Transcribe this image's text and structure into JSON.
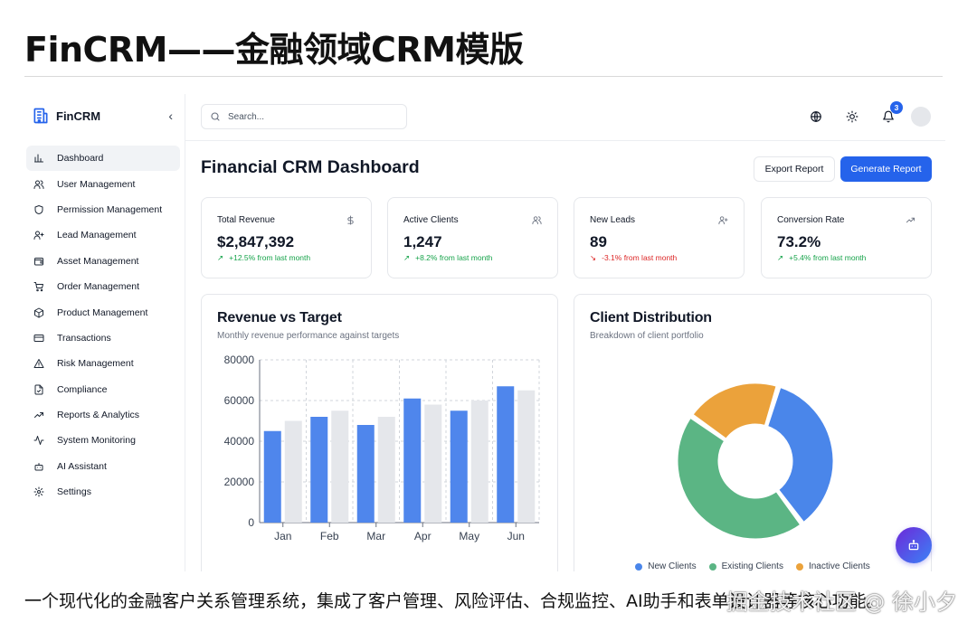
{
  "article": {
    "title": "FinCRM——金融领域CRM模版",
    "caption": "一个现代化的金融客户关系管理系统，集成了客户管理、风险评估、合规监控、AI助手和表单设计器等核心功能。",
    "watermark": "掘金技术社区 @ 徐小夕"
  },
  "brand": {
    "name": "FinCRM",
    "collapse_glyph": "‹"
  },
  "sidebar": {
    "items": [
      {
        "label": "Dashboard",
        "icon": "bar-chart-icon",
        "active": true
      },
      {
        "label": "User Management",
        "icon": "users-icon"
      },
      {
        "label": "Permission Management",
        "icon": "shield-icon"
      },
      {
        "label": "Lead Management",
        "icon": "user-plus-icon"
      },
      {
        "label": "Asset Management",
        "icon": "wallet-icon"
      },
      {
        "label": "Order Management",
        "icon": "cart-icon"
      },
      {
        "label": "Product Management",
        "icon": "package-icon"
      },
      {
        "label": "Transactions",
        "icon": "credit-card-icon"
      },
      {
        "label": "Risk Management",
        "icon": "alert-triangle-icon"
      },
      {
        "label": "Compliance",
        "icon": "file-check-icon"
      },
      {
        "label": "Reports & Analytics",
        "icon": "trending-up-icon"
      },
      {
        "label": "System Monitoring",
        "icon": "activity-icon"
      },
      {
        "label": "AI Assistant",
        "icon": "bot-icon"
      },
      {
        "label": "Settings",
        "icon": "gear-icon"
      }
    ]
  },
  "topbar": {
    "search_placeholder": "Search...",
    "notification_count": "3"
  },
  "page": {
    "title": "Financial CRM Dashboard",
    "export_label": "Export Report",
    "generate_label": "Generate Report"
  },
  "stats": [
    {
      "title": "Total Revenue",
      "value": "$2,847,392",
      "delta": "+12.5% from last month",
      "trend": "up",
      "icon": "dollar-icon"
    },
    {
      "title": "Active Clients",
      "value": "1,247",
      "delta": "+8.2% from last month",
      "trend": "up",
      "icon": "users-icon"
    },
    {
      "title": "New Leads",
      "value": "89",
      "delta": "-3.1% from last month",
      "trend": "down",
      "icon": "user-plus-icon"
    },
    {
      "title": "Conversion Rate",
      "value": "73.2%",
      "delta": "+5.4% from last month",
      "trend": "up",
      "icon": "trending-up-icon"
    }
  ],
  "colors": {
    "accent": "#2563eb",
    "bar_revenue": "#4f86ec",
    "bar_target": "#e5e7eb",
    "up": "#16a34a",
    "down": "#dc2626"
  },
  "chart_data": [
    {
      "type": "bar",
      "title": "Revenue vs Target",
      "subtitle": "Monthly revenue performance against targets",
      "categories": [
        "Jan",
        "Feb",
        "Mar",
        "Apr",
        "May",
        "Jun"
      ],
      "series": [
        {
          "values": [
            45000,
            52000,
            48000,
            61000,
            55000,
            67000
          ],
          "color": "#4f86ec"
        },
        {
          "values": [
            50000,
            55000,
            52000,
            58000,
            60000,
            65000
          ],
          "color": "#e5e7eb"
        }
      ],
      "ylim": [
        0,
        80000
      ],
      "yticks": [
        0,
        20000,
        40000,
        60000,
        80000
      ],
      "grid": true
    },
    {
      "type": "pie",
      "title": "Client Distribution",
      "subtitle": "Breakdown of client portfolio",
      "series": [
        {
          "name": "New Clients",
          "value": 35,
          "color": "#4a86ea"
        },
        {
          "name": "Existing Clients",
          "value": 45,
          "color": "#5bb584"
        },
        {
          "name": "Inactive Clients",
          "value": 20,
          "color": "#eba23b"
        }
      ],
      "legend_position": "bottom"
    }
  ]
}
